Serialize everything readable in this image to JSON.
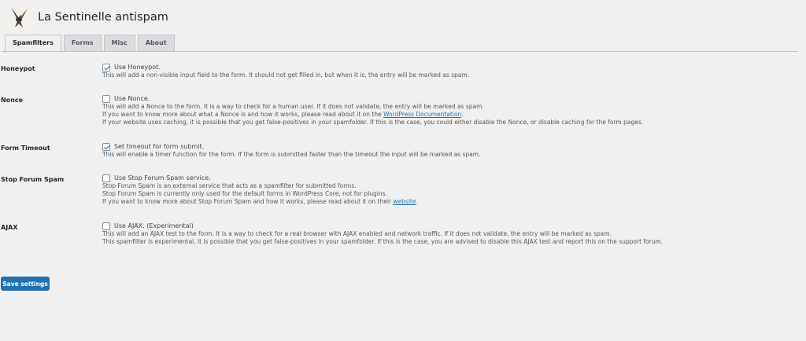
{
  "header": {
    "title": "La Sentinelle antispam"
  },
  "tabs": [
    "Spamfilters",
    "Forms",
    "Misc",
    "About"
  ],
  "settings": {
    "honeypot": {
      "label": "Honeypot",
      "option": "Use Honeypot.",
      "checked": true,
      "desc1": "This will add a non-visible input field to the form. It should not get filled in, but when it is, the entry will be marked as spam."
    },
    "nonce": {
      "label": "Nonce",
      "option": "Use Nonce.",
      "checked": false,
      "desc1": "This will add a Nonce to the form. It is a way to check for a human user. If it does not validate, the entry will be marked as spam.",
      "desc2_pre": "If you want to know more about what a Nonce is and how it works, please read about it on the ",
      "desc2_link": "WordPress Documentation",
      "desc2_post": ".",
      "desc3": "If your website uses caching, it is possible that you get false-positives in your spamfolder. If this is the case, you could either disable the Nonce, or disable caching for the form pages."
    },
    "timeout": {
      "label": "Form Timeout",
      "option": "Set timeout for form submit.",
      "checked": true,
      "desc1": "This will enable a timer function for the form. If the form is submitted faster than the timeout the input will be marked as spam."
    },
    "sfs": {
      "label": "Stop Forum Spam",
      "option": "Use Stop Forum Spam service.",
      "checked": false,
      "desc1": "Stop Forum Spam is an external service that acts as a spamfilter for submitted forms.",
      "desc2": "Stop Forum Spam is currently only used for the default forms in WordPress Core, not for plugins.",
      "desc3_pre": "If you want to know more about Stop Forum Spam and how it works, please read about it on their ",
      "desc3_link": "website",
      "desc3_post": "."
    },
    "ajax": {
      "label": "AJAX",
      "option": "Use AJAX. (Experimental)",
      "checked": false,
      "desc1": "This will add an AJAX test to the form. It is a way to check for a real browser with AJAX enabled and network traffic. If it does not validate, the entry will be marked as spam.",
      "desc2": "This spamfilter is experimental, it is possible that you get false-positives in your spamfolder. If this is the case, you are advised to disable this AJAX test and report this on the support forum."
    }
  },
  "save_label": "Save settings",
  "colors": {
    "accent": "#2271b1",
    "background": "#f0f0f1"
  }
}
